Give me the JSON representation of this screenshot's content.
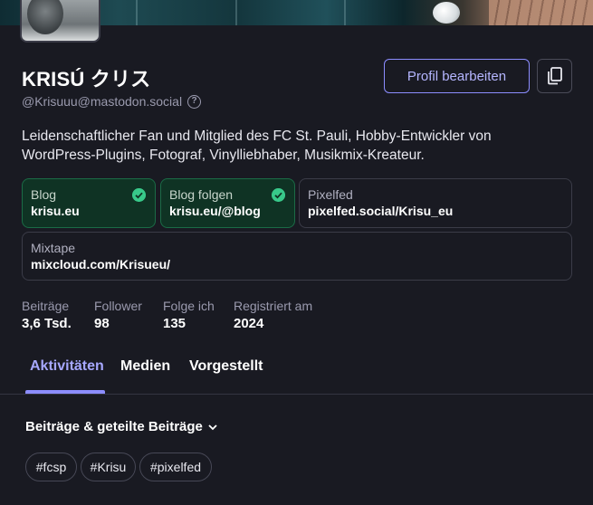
{
  "profile": {
    "display_name": "KRISÚ クリス",
    "handle": "@Krisuuu@mastodon.social",
    "bio": "Leidenschaftlicher Fan und Mitglied des FC St. Pauli, Hobby-Entwickler von WordPress-Plugins, Fotograf, Vinylliebhaber, Musikmix-Kreateur."
  },
  "actions": {
    "edit_label": "Profil bearbeiten"
  },
  "fields": [
    {
      "label": "Blog",
      "value": "krisu.eu",
      "verified": true
    },
    {
      "label": "Blog folgen",
      "value": "krisu.eu/@blog",
      "verified": true
    },
    {
      "label": "Pixelfed",
      "value": "pixelfed.social/Krisu_eu",
      "verified": false
    },
    {
      "label": "Mixtape",
      "value": "mixcloud.com/Krisueu/",
      "verified": false
    }
  ],
  "stats": [
    {
      "label": "Beiträge",
      "value": "3,6 Tsd."
    },
    {
      "label": "Follower",
      "value": "98"
    },
    {
      "label": "Folge ich",
      "value": "135"
    },
    {
      "label": "Registriert am",
      "value": "2024"
    }
  ],
  "tabs": [
    {
      "label": "Aktivitäten",
      "active": true
    },
    {
      "label": "Medien",
      "active": false
    },
    {
      "label": "Vorgestellt",
      "active": false
    }
  ],
  "filter": {
    "label": "Beiträge & geteilte Beiträge"
  },
  "hashtags": [
    "#fcsp",
    "#Krisu",
    "#pixelfed"
  ],
  "colors": {
    "background": "#191a22",
    "accent": "#8c8dff",
    "verified_bg": "#0f3324",
    "verified_check": "#38c98a"
  },
  "icons": {
    "help": "help-circle-icon",
    "copy": "copy-icon",
    "verified": "check-circle-icon",
    "filter_dropdown": "chevron-down-icon"
  }
}
